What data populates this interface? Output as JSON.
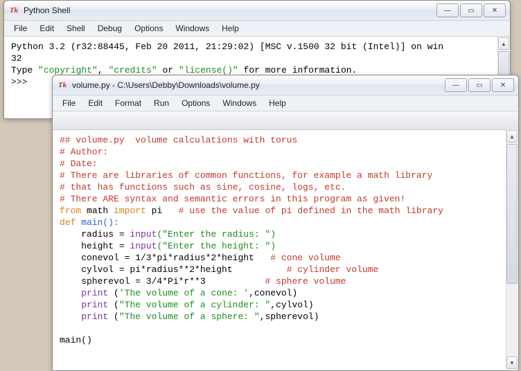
{
  "shell": {
    "title": "Python Shell",
    "icon": "Tk",
    "menu": [
      "File",
      "Edit",
      "Shell",
      "Debug",
      "Options",
      "Windows",
      "Help"
    ],
    "lines": {
      "l1": "Python 3.2 (r32:88445, Feb 20 2011, 21:29:02) [MSC v.1500 32 bit (Intel)] on win",
      "l2": "32",
      "l3a": "Type ",
      "l3b": "\"copyright\"",
      "l3c": ", ",
      "l3d": "\"credits\"",
      "l3e": " or ",
      "l3f": "\"license()\"",
      "l3g": " for more information.",
      "prompt": ">>> "
    }
  },
  "editor": {
    "title": "volume.py - C:\\Users\\Debby\\Downloads\\volume.py",
    "icon": "Tk",
    "menu": [
      "File",
      "Edit",
      "Format",
      "Run",
      "Options",
      "Windows",
      "Help"
    ],
    "code": {
      "c1": "## volume.py  volume calculations with torus",
      "c2": "# Author:",
      "c3": "# Date:",
      "c4": "# There are libraries of common functions, for example a math library",
      "c5": "# that has functions such as sine, cosine, logs, etc.",
      "c6": "# There ARE syntax and semantic errors in this program as given!",
      "l7_from": "from",
      "l7_mod": " math ",
      "l7_import": "import",
      "l7_pi": " pi   ",
      "l7_c": "# use the value of pi defined in the math library",
      "l8_def": "def",
      "l8_name": " main():",
      "l9_pre": "    radius = ",
      "l9_fn": "input",
      "l9_s": "(\"Enter the radius: \")",
      "l10_pre": "    height = ",
      "l10_fn": "input",
      "l10_s": "(\"Enter the height: \")",
      "l11_a": "    conevol = 1/3*pi*radius*2*height   ",
      "l11_c": "# cone volume",
      "l12_a": "    cylvol = pi*radius**2*height          ",
      "l12_c": "# cylinder volume",
      "l13_a": "    spherevol = 3/4*Pi*r**3           ",
      "l13_c": "# sphere volume",
      "l14_pre": "    ",
      "l14_fn": "print",
      "l14_open": " (",
      "l14_s": "'The volume of a cone: '",
      "l14_rest": ",conevol)",
      "l15_pre": "    ",
      "l15_fn": "print",
      "l15_open": " (",
      "l15_s": "\"The volume of a cylinder: \"",
      "l15_rest": ",cylvol)",
      "l16_pre": "    ",
      "l16_fn": "print",
      "l16_open": " (",
      "l16_s": "\"The volume of a sphere: \"",
      "l16_rest": ",spherevol)",
      "l17": "",
      "l18": "main()"
    }
  },
  "winctrl": {
    "min": "—",
    "max": "▭",
    "close": "✕"
  }
}
